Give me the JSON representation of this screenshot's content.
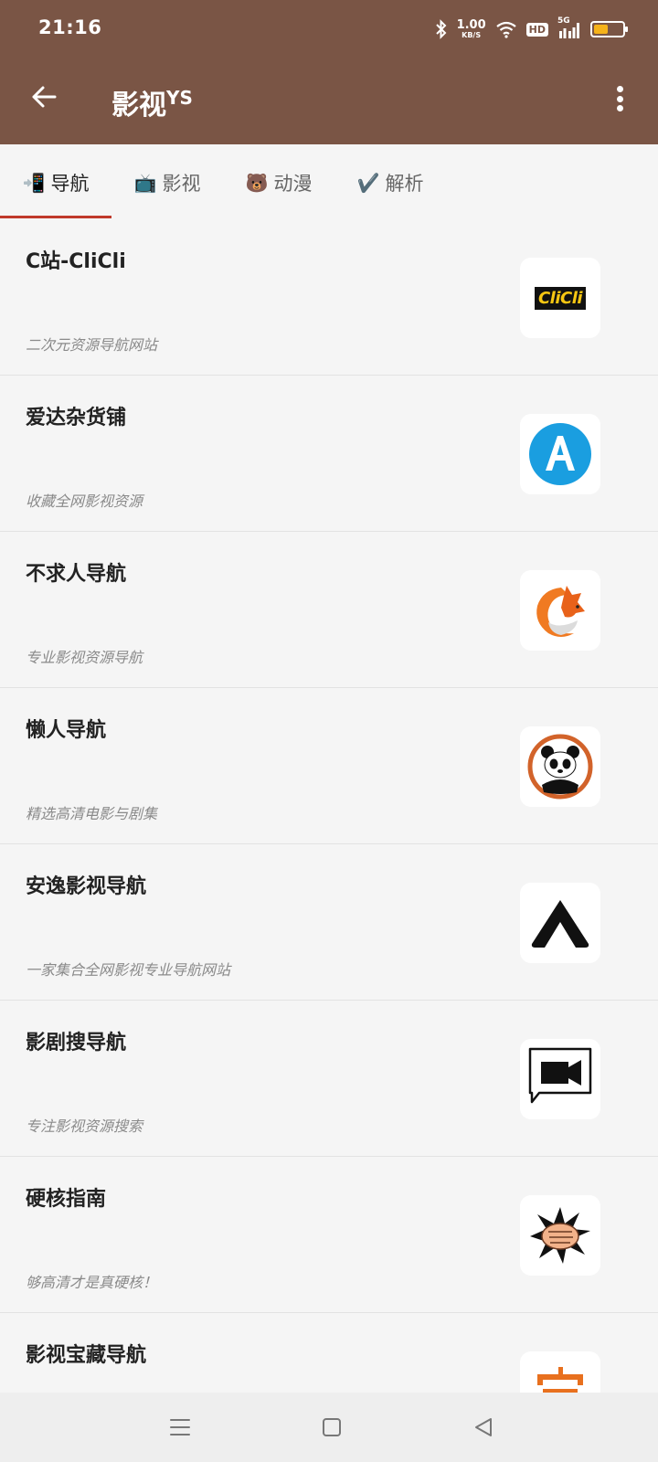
{
  "status": {
    "time": "21:16",
    "net_speed_value": "1.00",
    "net_speed_unit": "KB/S",
    "hd": "HD",
    "signal_type": "5G",
    "battery_level": 0.55
  },
  "appbar": {
    "title": "影视",
    "title_suffix": "YS"
  },
  "tabs": [
    {
      "emoji": "📲",
      "label": "导航"
    },
    {
      "emoji": "📺",
      "label": "影视"
    },
    {
      "emoji": "🐻",
      "label": "动漫"
    },
    {
      "emoji": "✔️",
      "label": "解析"
    }
  ],
  "list": [
    {
      "title": "C站-CliCli",
      "desc": "二次元资源导航网站",
      "icon": "clicli-logo"
    },
    {
      "title": "爱达杂货铺",
      "desc": "收藏全网影视资源",
      "icon": "letter-a-logo"
    },
    {
      "title": "不求人导航",
      "desc": "专业影视资源导航",
      "icon": "fox-logo"
    },
    {
      "title": "懒人导航",
      "desc": "精选高清电影与剧集",
      "icon": "panda-logo"
    },
    {
      "title": "安逸影视导航",
      "desc": "一家集合全网影视专业导航网站",
      "icon": "chevron-up-logo"
    },
    {
      "title": "影剧搜导航",
      "desc": "专注影视资源搜索",
      "icon": "video-camera-logo"
    },
    {
      "title": "硬核指南",
      "desc": "够高清才是真硬核！",
      "icon": "fist-logo"
    },
    {
      "title": "影视宝藏导航",
      "desc": "",
      "icon": "treasure-logo"
    }
  ],
  "logo_text": {
    "clicli": "CliCli"
  },
  "colors": {
    "appbar": "#7a5545",
    "tab_indicator": "#c0392b",
    "battery": "#f5b21a"
  }
}
